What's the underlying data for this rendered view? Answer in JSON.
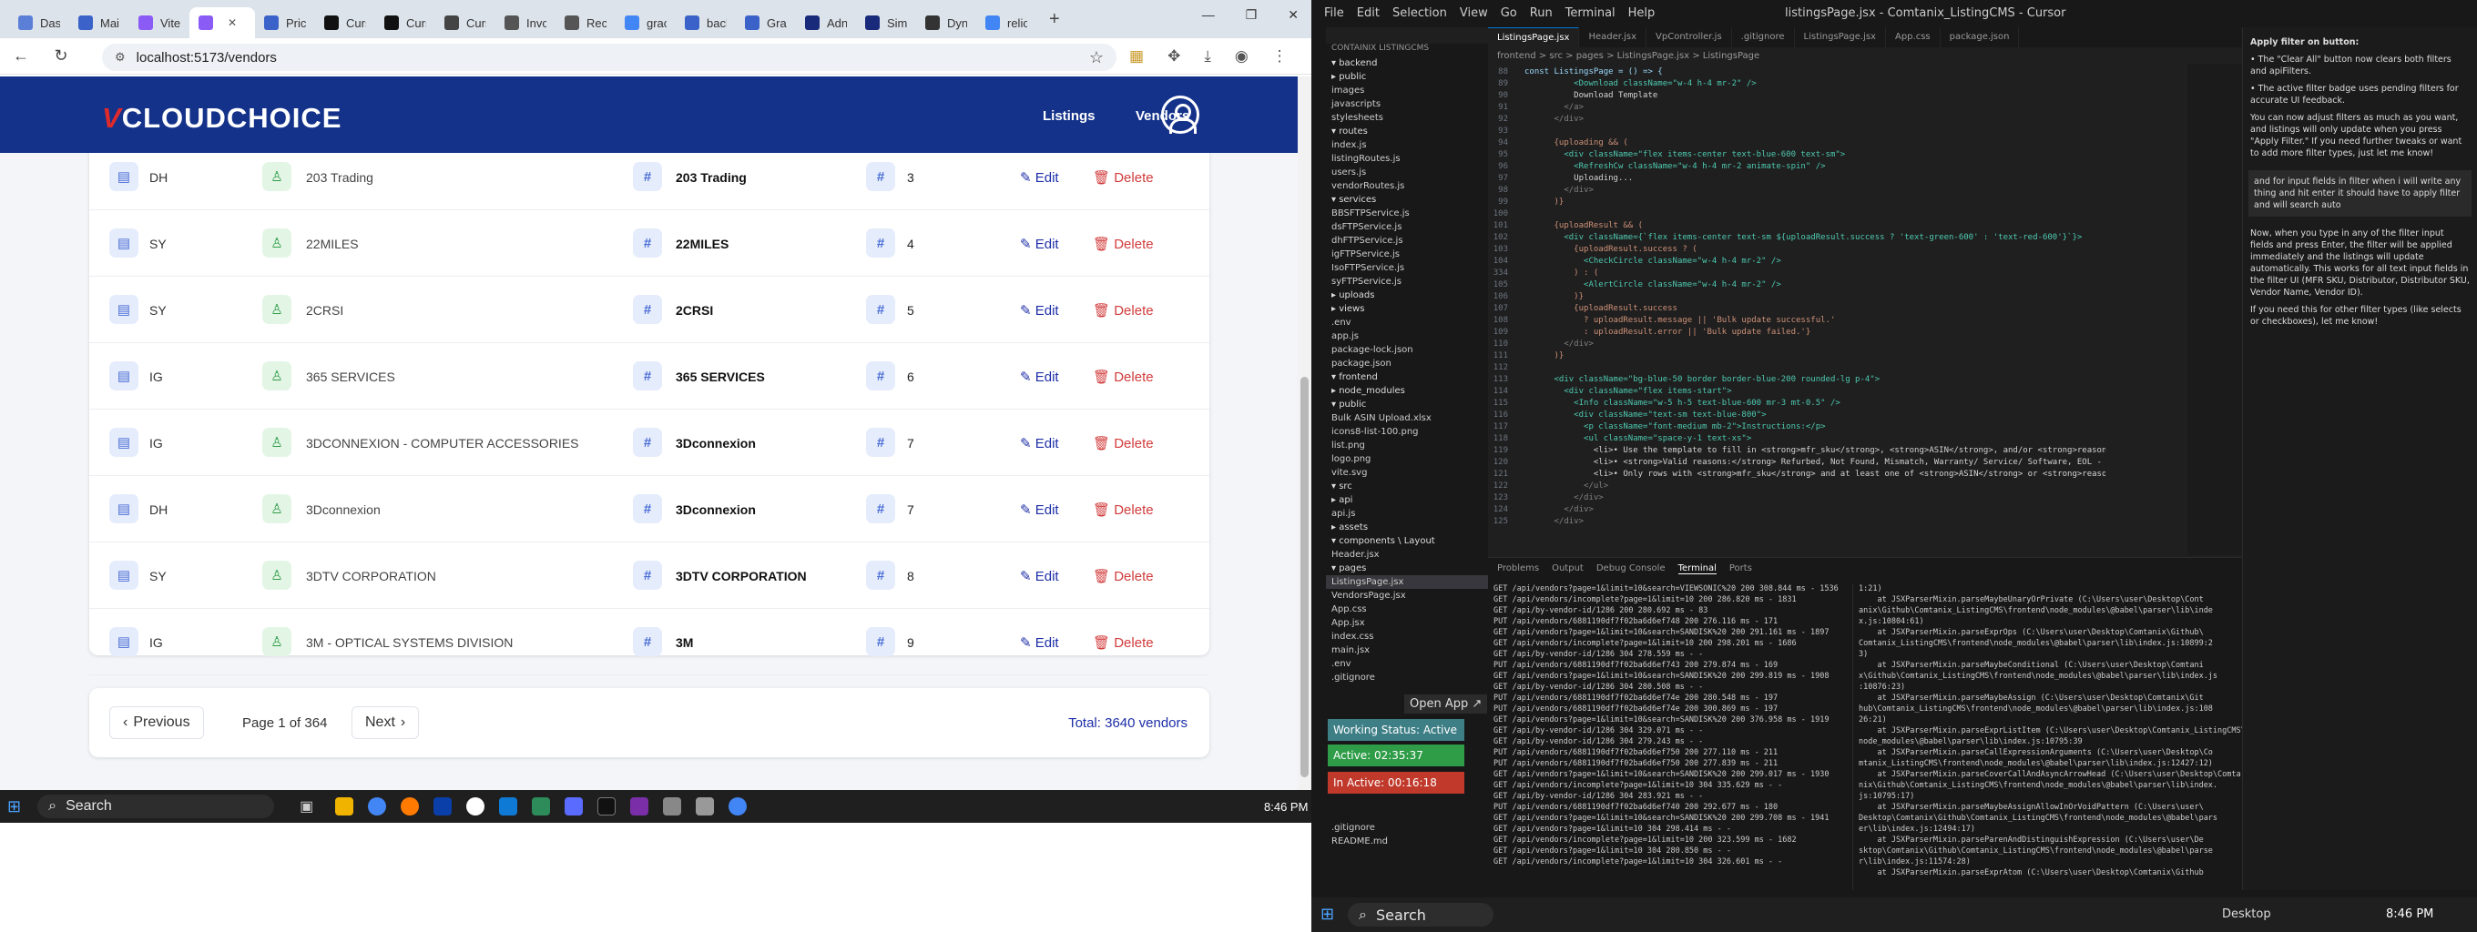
{
  "browser": {
    "tabs": [
      {
        "label": "Das",
        "color": "#5b7fd6"
      },
      {
        "label": "Mai",
        "color": "#3a62c9"
      },
      {
        "label": "Vite",
        "color": "#8a5cf5"
      },
      {
        "label": "",
        "color": "#8a5cf5",
        "active": true
      },
      {
        "label": "Pric",
        "color": "#3a62c9"
      },
      {
        "label": "Curs",
        "color": "#111111"
      },
      {
        "label": "Curs",
        "color": "#111111"
      },
      {
        "label": "Curs",
        "color": "#444444"
      },
      {
        "label": "Invc",
        "color": "#555555"
      },
      {
        "label": "Rec",
        "color": "#555555"
      },
      {
        "label": "grac",
        "color": "#4285f4"
      },
      {
        "label": "bacl",
        "color": "#3a62c9"
      },
      {
        "label": "Grac",
        "color": "#3a62c9"
      },
      {
        "label": "Adn",
        "color": "#1a2a7a"
      },
      {
        "label": "Sim",
        "color": "#1a2a7a"
      },
      {
        "label": "Dyn",
        "color": "#333333"
      },
      {
        "label": "relic",
        "color": "#4285f4"
      }
    ],
    "url": "localhost:5173/vendors",
    "window_controls": [
      "—",
      "❐",
      "✕"
    ]
  },
  "app": {
    "logo_v": "V",
    "logo_rest": "CLOUDCHOICE",
    "nav": {
      "listings": "Listings",
      "vendors": "Vendors"
    }
  },
  "vendors": [
    {
      "code": "DH",
      "name": "203 Trading",
      "display": "203 Trading",
      "id": "3"
    },
    {
      "code": "SY",
      "name": "22MILES",
      "display": "22MILES",
      "id": "4"
    },
    {
      "code": "SY",
      "name": "2CRSI",
      "display": "2CRSI",
      "id": "5"
    },
    {
      "code": "IG",
      "name": "365 SERVICES",
      "display": "365 SERVICES",
      "id": "6"
    },
    {
      "code": "IG",
      "name": "3DCONNEXION - COMPUTER ACCESSORIES",
      "display": "3Dconnexion",
      "id": "7"
    },
    {
      "code": "DH",
      "name": "3Dconnexion",
      "display": "3Dconnexion",
      "id": "7"
    },
    {
      "code": "SY",
      "name": "3DTV CORPORATION",
      "display": "3DTV CORPORATION",
      "id": "8"
    },
    {
      "code": "IG",
      "name": "3M - OPTICAL SYSTEMS DIVISION",
      "display": "3M",
      "id": "9"
    }
  ],
  "actions": {
    "edit": "Edit",
    "delete": "Delete"
  },
  "pager": {
    "previous": "Previous",
    "next": "Next",
    "info": "Page 1 of 364",
    "total": "Total: 3640 vendors"
  },
  "taskbar_left": {
    "search": "Search",
    "time": "8:46 PM"
  },
  "vscode": {
    "menu": [
      "File",
      "Edit",
      "Selection",
      "View",
      "Go",
      "Run",
      "Terminal",
      "Help"
    ],
    "title": "listingsPage.jsx - Comtanix_ListingCMS - Cursor",
    "tabs": [
      "ListingsPage.jsx",
      "Header.jsx",
      "VpController.js",
      ".gitignore",
      "ListingsPage.jsx",
      "App.css",
      "package.json"
    ],
    "breadcrumb": "frontend > src > pages > ListingsPage.jsx > ListingsPage",
    "code": [
      {
        "n": "88",
        "t": "const ListingsPage = () => {",
        "c": "#9cdcfe"
      },
      {
        "n": "89",
        "t": "          <Download className=\"w-4 h-4 mr-2\" />",
        "c": "#4ec9b0"
      },
      {
        "n": "90",
        "t": "          Download Template",
        "c": "#d4d4d4"
      },
      {
        "n": "91",
        "t": "        </a>",
        "c": "#808080"
      },
      {
        "n": "92",
        "t": "      </div>",
        "c": "#808080"
      },
      {
        "n": "93",
        "t": "",
        "c": "#d4d4d4"
      },
      {
        "n": "94",
        "t": "      {uploading && (",
        "c": "#ce9178"
      },
      {
        "n": "95",
        "t": "        <div className=\"flex items-center text-blue-600 text-sm\">",
        "c": "#4ec9b0"
      },
      {
        "n": "96",
        "t": "          <RefreshCw className=\"w-4 h-4 mr-2 animate-spin\" />",
        "c": "#4ec9b0"
      },
      {
        "n": "97",
        "t": "          Uploading...",
        "c": "#d4d4d4"
      },
      {
        "n": "98",
        "t": "        </div>",
        "c": "#808080"
      },
      {
        "n": "99",
        "t": "      )}",
        "c": "#ce9178"
      },
      {
        "n": "100",
        "t": "",
        "c": "#d4d4d4"
      },
      {
        "n": "101",
        "t": "      {uploadResult && (",
        "c": "#ce9178"
      },
      {
        "n": "102",
        "t": "        <div className={`flex items-center text-sm ${uploadResult.success ? 'text-green-600' : 'text-red-600'}`}>",
        "c": "#4ec9b0"
      },
      {
        "n": "103",
        "t": "          {uploadResult.success ? (",
        "c": "#ce9178"
      },
      {
        "n": "104",
        "t": "            <CheckCircle className=\"w-4 h-4 mr-2\" />",
        "c": "#4ec9b0"
      },
      {
        "n": "334",
        "t": "          ) : (",
        "c": "#ce9178"
      },
      {
        "n": "105",
        "t": "            <AlertCircle className=\"w-4 h-4 mr-2\" />",
        "c": "#4ec9b0"
      },
      {
        "n": "106",
        "t": "          )}",
        "c": "#ce9178"
      },
      {
        "n": "107",
        "t": "          {uploadResult.success",
        "c": "#ce9178"
      },
      {
        "n": "108",
        "t": "            ? uploadResult.message || 'Bulk update successful.'",
        "c": "#ce9178"
      },
      {
        "n": "109",
        "t": "            : uploadResult.error || 'Bulk update failed.'}",
        "c": "#ce9178"
      },
      {
        "n": "110",
        "t": "        </div>",
        "c": "#808080"
      },
      {
        "n": "111",
        "t": "      )}",
        "c": "#ce9178"
      },
      {
        "n": "112",
        "t": "",
        "c": "#d4d4d4"
      },
      {
        "n": "113",
        "t": "      <div className=\"bg-blue-50 border border-blue-200 rounded-lg p-4\">",
        "c": "#4ec9b0"
      },
      {
        "n": "114",
        "t": "        <div className=\"flex items-start\">",
        "c": "#4ec9b0"
      },
      {
        "n": "115",
        "t": "          <Info className=\"w-5 h-5 text-blue-600 mr-3 mt-0.5\" />",
        "c": "#4ec9b0"
      },
      {
        "n": "116",
        "t": "          <div className=\"text-sm text-blue-800\">",
        "c": "#4ec9b0"
      },
      {
        "n": "117",
        "t": "            <p className=\"font-medium mb-2\">Instructions:</p>",
        "c": "#4ec9b0"
      },
      {
        "n": "118",
        "t": "            <ul className=\"space-y-1 text-xs\">",
        "c": "#4ec9b0"
      },
      {
        "n": "119",
        "t": "              <li>• Use the template to fill in <strong>mfr_sku</strong>, <strong>ASIN</strong>, and/or <strong>reason</strong>",
        "c": "#d4d4d4"
      },
      {
        "n": "120",
        "t": "              <li>• <strong>Valid reasons:</strong> Refurbed, Not Found, Mismatch, Warranty/ Service/ Software, EOL - Not Fo",
        "c": "#d4d4d4"
      },
      {
        "n": "121",
        "t": "              <li>• Only rows with <strong>mfr_sku</strong> and at least one of <strong>ASIN</strong> or <strong>reason</str",
        "c": "#d4d4d4"
      },
      {
        "n": "122",
        "t": "            </ul>",
        "c": "#808080"
      },
      {
        "n": "123",
        "t": "          </div>",
        "c": "#808080"
      },
      {
        "n": "124",
        "t": "        </div>",
        "c": "#808080"
      },
      {
        "n": "125",
        "t": "      </div>",
        "c": "#808080"
      }
    ],
    "explorer": [
      {
        "t": "CONTAINIX LISTINGCMS",
        "k": "head"
      },
      {
        "t": "▾ backend",
        "k": "folder"
      },
      {
        "t": "  ▸ public",
        "k": "folder"
      },
      {
        "t": "    images",
        "k": "file"
      },
      {
        "t": "    javascripts",
        "k": "file"
      },
      {
        "t": "    stylesheets",
        "k": "file"
      },
      {
        "t": "  ▾ routes",
        "k": "folder"
      },
      {
        "t": "    index.js",
        "k": "file"
      },
      {
        "t": "    listingRoutes.js",
        "k": "file"
      },
      {
        "t": "    users.js",
        "k": "file"
      },
      {
        "t": "    vendorRoutes.js",
        "k": "file"
      },
      {
        "t": "  ▾ services",
        "k": "folder"
      },
      {
        "t": "    BBSFTPService.js",
        "k": "file"
      },
      {
        "t": "    dsFTPService.js",
        "k": "file"
      },
      {
        "t": "    dhFTPService.js",
        "k": "file"
      },
      {
        "t": "    igFTPService.js",
        "k": "file"
      },
      {
        "t": "    IsoFTPService.js",
        "k": "file"
      },
      {
        "t": "    syFTPService.js",
        "k": "file"
      },
      {
        "t": "  ▸ uploads",
        "k": "folder"
      },
      {
        "t": "  ▸ views",
        "k": "folder"
      },
      {
        "t": "    .env",
        "k": "file"
      },
      {
        "t": "    app.js",
        "k": "file"
      },
      {
        "t": "    package-lock.json",
        "k": "file"
      },
      {
        "t": "    package.json",
        "k": "file"
      },
      {
        "t": "▾ frontend",
        "k": "folder"
      },
      {
        "t": "  ▸ node_modules",
        "k": "folder"
      },
      {
        "t": "  ▾ public",
        "k": "folder"
      },
      {
        "t": "    Bulk ASIN Upload.xlsx",
        "k": "file"
      },
      {
        "t": "    icons8-list-100.png",
        "k": "file"
      },
      {
        "t": "    list.png",
        "k": "file"
      },
      {
        "t": "    logo.png",
        "k": "file"
      },
      {
        "t": "    vite.svg",
        "k": "file"
      },
      {
        "t": "  ▾ src",
        "k": "folder"
      },
      {
        "t": "    ▸ api",
        "k": "folder"
      },
      {
        "t": "      api.js",
        "k": "file"
      },
      {
        "t": "    ▸ assets",
        "k": "folder"
      },
      {
        "t": "    ▾ components \\ Layout",
        "k": "folder"
      },
      {
        "t": "      Header.jsx",
        "k": "file"
      },
      {
        "t": "    ▾ pages",
        "k": "folder"
      },
      {
        "t": "      ListingsPage.jsx",
        "k": "sel"
      },
      {
        "t": "      VendorsPage.jsx",
        "k": "file"
      },
      {
        "t": "    App.css",
        "k": "file"
      },
      {
        "t": "    App.jsx",
        "k": "file"
      },
      {
        "t": "    index.css",
        "k": "file"
      },
      {
        "t": "    main.jsx",
        "k": "file"
      },
      {
        "t": "  .env",
        "k": "file"
      },
      {
        "t": "  .gitignore",
        "k": "file"
      }
    ],
    "explorer_bottom": [
      ".gitignore",
      "README.md"
    ],
    "open_app": "Open App ↗",
    "working_status": "Working Status: Active",
    "active_time": "Active: 02:35:37",
    "inactive_time": "In Active: 00:16:18",
    "panel_tabs": [
      "Problems",
      "Output",
      "Debug Console",
      "Terminal",
      "Ports"
    ],
    "terminal_left": [
      "GET /api/vendors?page=1&limit=10&search=VIEWSONIC%20 200 308.844 ms - 1536",
      "GET /api/vendors/incomplete?page=1&limit=10 200 286.820 ms - 1831",
      "GET /api/by-vendor-id/1286 200 280.692 ms - 83",
      "PUT /api/vendors/6881190df7f02ba6d6ef748 200 276.116 ms - 171",
      "GET /api/vendors?page=1&limit=10&search=SANDISK%20 200 291.161 ms - 1897",
      "GET /api/vendors/incomplete?page=1&limit=10 200 298.201 ms - 1686",
      "GET /api/by-vendor-id/1286 304 278.559 ms - -",
      "PUT /api/vendors/6881190df7f02ba6d6ef743 200 279.874 ms - 169",
      "GET /api/vendors?page=1&limit=10&search=SANDISK%20 200 299.819 ms - 1908",
      "GET /api/by-vendor-id/1286 304 280.508 ms - -",
      "PUT /api/vendors/6881190df7f02ba6d6ef74e 200 280.548 ms - 197",
      "PUT /api/vendors/6881190df7f02ba6d6ef74e 200 300.869 ms - 197",
      "GET /api/vendors?page=1&limit=10&search=SANDISK%20 200 376.958 ms - 1919",
      "GET /api/by-vendor-id/1286 304 329.071 ms - -",
      "GET /api/by-vendor-id/1286 304 279.243 ms - -",
      "PUT /api/vendors/6881190df7f02ba6d6ef750 200 277.110 ms - 211",
      "PUT /api/vendors/6881190df7f02ba6d6ef750 200 277.839 ms - 211",
      "GET /api/vendors?page=1&limit=10&search=SANDISK%20 200 299.017 ms - 1930",
      "GET /api/vendors/incomplete?page=1&limit=10 304 335.629 ms - -",
      "GET /api/by-vendor-id/1286 304 283.921 ms - -",
      "PUT /api/vendors/6881190df7f02ba6d6ef740 200 292.677 ms - 180",
      "GET /api/vendors?page=1&limit=10&search=SANDISK%20 200 299.708 ms - 1941",
      "GET /api/vendors?page=1&limit=10 304 298.414 ms - -",
      "GET /api/vendors/incomplete?page=1&limit=10 200 323.599 ms - 1682",
      "GET /api/vendors?page=1&limit=10 304 280.850 ms - -",
      "GET /api/vendors/incomplete?page=1&limit=10 304 326.601 ms - -"
    ],
    "terminal_right": [
      "1:21)",
      "    at JSXParserMixin.parseMaybeUnaryOrPrivate (C:\\Users\\user\\Desktop\\Cont",
      "anix\\Github\\Comtanix_ListingCMS\\frontend\\node_modules\\@babel\\parser\\lib\\inde",
      "x.js:10804:61)",
      "    at JSXParserMixin.parseExprOps (C:\\Users\\user\\Desktop\\Comtanix\\Github\\",
      "Comtanix_ListingCMS\\frontend\\node_modules\\@babel\\parser\\lib\\index.js:10899:2",
      "3)",
      "    at JSXParserMixin.parseMaybeConditional (C:\\Users\\user\\Desktop\\Comtani",
      "x\\Github\\Comtanix_ListingCMS\\frontend\\node_modules\\@babel\\parser\\lib\\index.js",
      ":10876:23)",
      "    at JSXParserMixin.parseMaybeAssign (C:\\Users\\user\\Desktop\\Comtanix\\Git",
      "hub\\Comtanix_ListingCMS\\frontend\\node_modules\\@babel\\parser\\lib\\index.js:108",
      "26:21)",
      "    at JSXParserMixin.parseExprListItem (C:\\Users\\user\\Desktop\\Comtanix_ListingCMS\\frontend\\",
      "node_modules\\@babel\\parser\\lib\\index.js:10795:39",
      "    at JSXParserMixin.parseCallExpressionArguments (C:\\Users\\user\\Desktop\\Co",
      "mtanix_ListingCMS\\frontend\\node_modules\\@babel\\parser\\lib\\index.js:12427:12)",
      "    at JSXParserMixin.parseCoverCallAndAsyncArrowHead (C:\\Users\\user\\Desktop\\Comta",
      "nix\\Github\\Comtanix_ListingCMS\\frontend\\node_modules\\@babel\\parser\\lib\\index.",
      "js:10795:17)",
      "    at JSXParserMixin.parseMaybeAssignAllowInOrVoidPattern (C:\\Users\\user\\",
      "Desktop\\Comtanix\\Github\\Comtanix_ListingCMS\\frontend\\node_modules\\@babel\\pars",
      "er\\lib\\index.js:12494:17)",
      "    at JSXParserMixin.parseParenAndDistinguishExpression (C:\\Users\\user\\De",
      "sktop\\Comtanix\\Github\\Comtanix_ListingCMS\\frontend\\node_modules\\@babel\\parse",
      "r\\lib\\index.js:11574:28)",
      "    at JSXParserMixin.parseExprAtom (C:\\Users\\user\\Desktop\\Comtanix\\Github"
    ],
    "chat": [
      "Apply filter on button:",
      "• The \"Clear All\" button now clears both filters and apiFilters.",
      "• The active filter badge uses pending filters for accurate UI feedback.",
      "You can now adjust filters as much as you want, and listings will only update when you press \"Apply Filter.\" If you need further tweaks or want to add more filter types, just let me know!",
      "and for input fields in filter when i will write any thing and hit enter it should have to apply filter and will search auto",
      "Now, when you type in any of the filter input fields and press Enter, the filter will be applied immediately and the listings will update automatically. This works for all text input fields in the filter UI (MFR SKU, Distributor, Distributor SKU, Vendor Name, Vendor ID).",
      "If you need this for other filter types (like selects or checkboxes), let me know!"
    ],
    "taskbar": {
      "search": "Search",
      "desktop": "Desktop",
      "time": "8:46 PM"
    }
  }
}
